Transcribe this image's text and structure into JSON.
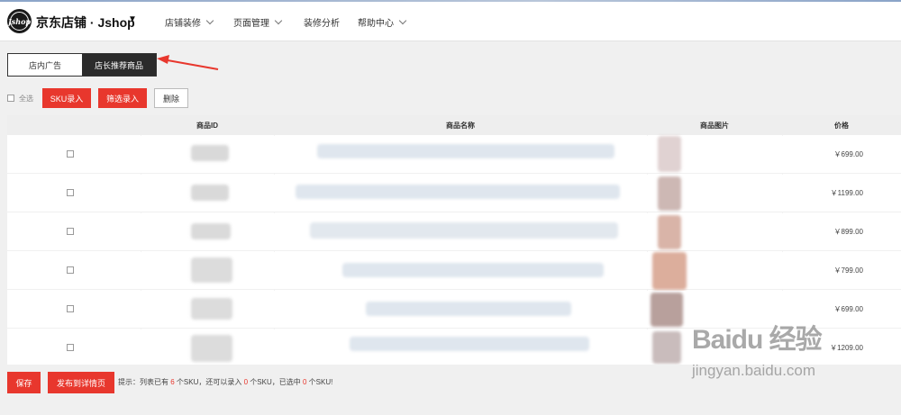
{
  "header": {
    "logo_text": "Jshop",
    "brand": "京东店铺 · Jshop",
    "nav": [
      "店铺装修",
      "页面管理",
      "装修分析",
      "帮助中心"
    ]
  },
  "tabs": [
    "店内广告",
    "店长推荐商品"
  ],
  "active_tab": "店长推荐商品",
  "toolbar": {
    "select_all": "全选",
    "sku_entry": "SKU录入",
    "filter_entry": "筛选录入",
    "delete": "删除"
  },
  "table": {
    "columns": [
      "商品ID",
      "商品名称",
      "商品图片",
      "价格"
    ],
    "rows": [
      {
        "price": "￥699.00"
      },
      {
        "price": "￥1199.00"
      },
      {
        "price": "￥899.00"
      },
      {
        "price": "￥799.00"
      },
      {
        "price": "￥699.00"
      },
      {
        "price": "￥1209.00"
      }
    ]
  },
  "footer": {
    "save": "保存",
    "publish": "发布到详情页",
    "hint_prefix": "提示：列表已有",
    "hint_count1": "6",
    "hint_mid1": "个SKU，还可以录入",
    "hint_count2": "0",
    "hint_mid2": "个SKU，已选中",
    "hint_count3": "0",
    "hint_suffix": "个SKU!"
  },
  "watermark": {
    "main": "Baidu 经验",
    "sub": "jingyan.baidu.com"
  },
  "colors": {
    "accent_red": "#e8372d",
    "dark_tab": "#2b2b2b"
  }
}
